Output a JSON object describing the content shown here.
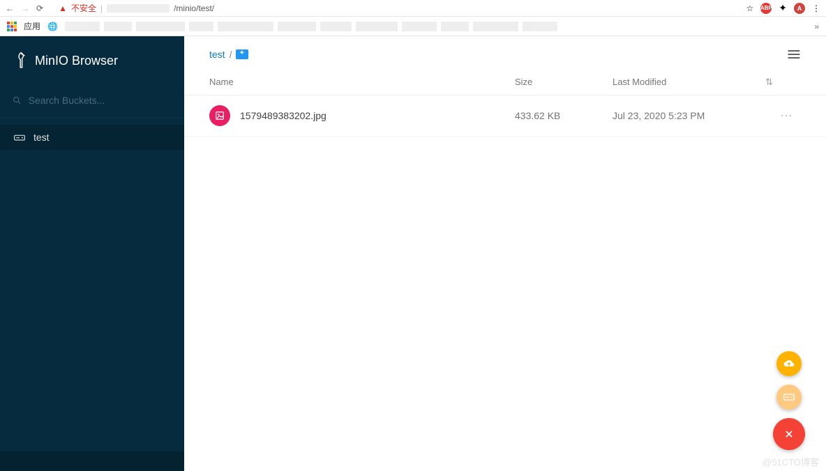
{
  "chrome": {
    "security_label": "不安全",
    "url_visible": "/minio/test/",
    "apps_label": "应用",
    "abp_text": "ABP",
    "avatar_letter": "A",
    "overflow": "»"
  },
  "sidebar": {
    "app_title": "MinIO Browser",
    "search_placeholder": "Search Buckets...",
    "buckets": [
      {
        "name": "test",
        "active": true
      }
    ]
  },
  "main": {
    "breadcrumb": {
      "bucket": "test",
      "sep": "/"
    },
    "columns": {
      "name": "Name",
      "size": "Size",
      "modified": "Last Modified"
    },
    "files": [
      {
        "name": "1579489383202.jpg",
        "size": "433.62 KB",
        "modified": "Jul 23, 2020 5:23 PM"
      }
    ]
  },
  "watermark": "@51CTO博客"
}
